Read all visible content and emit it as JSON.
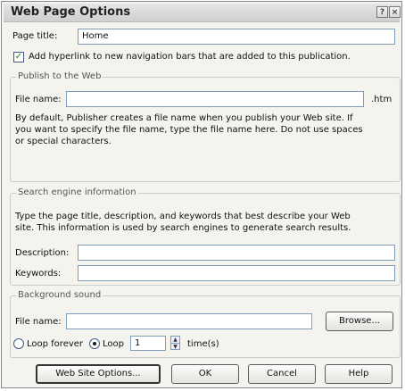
{
  "window": {
    "title": "Web Page Options",
    "help_glyph": "?",
    "close_glyph": "×"
  },
  "page_title": {
    "label": "Page title:",
    "value": "Home"
  },
  "add_hyperlink": {
    "label": "Add hyperlink to new navigation bars that are added to this publication.",
    "checked": true
  },
  "publish": {
    "title": "Publish to the Web",
    "file_name_label": "File name:",
    "file_name_value": "",
    "extension": ".htm",
    "description": "By default, Publisher creates a file name when you publish your Web site. If\nyou want to specify the file name, type the file name here. Do not use spaces\nor special characters."
  },
  "search": {
    "title": "Search engine information",
    "description": "Type the page title, description, and keywords that best describe your Web\nsite. This information is used by search engines to generate search results.",
    "description_label": "Description:",
    "description_value": "",
    "keywords_label": "Keywords:",
    "keywords_value": ""
  },
  "sound": {
    "title": "Background sound",
    "file_name_label": "File name:",
    "file_name_value": "",
    "browse_label": "Browse...",
    "loop_forever_label": "Loop forever",
    "loop_label": "Loop",
    "loop_count": "1",
    "times_label": "time(s)",
    "selected": "loop"
  },
  "buttons": {
    "site_options": "Web Site Options...",
    "ok": "OK",
    "cancel": "Cancel",
    "help": "Help"
  }
}
